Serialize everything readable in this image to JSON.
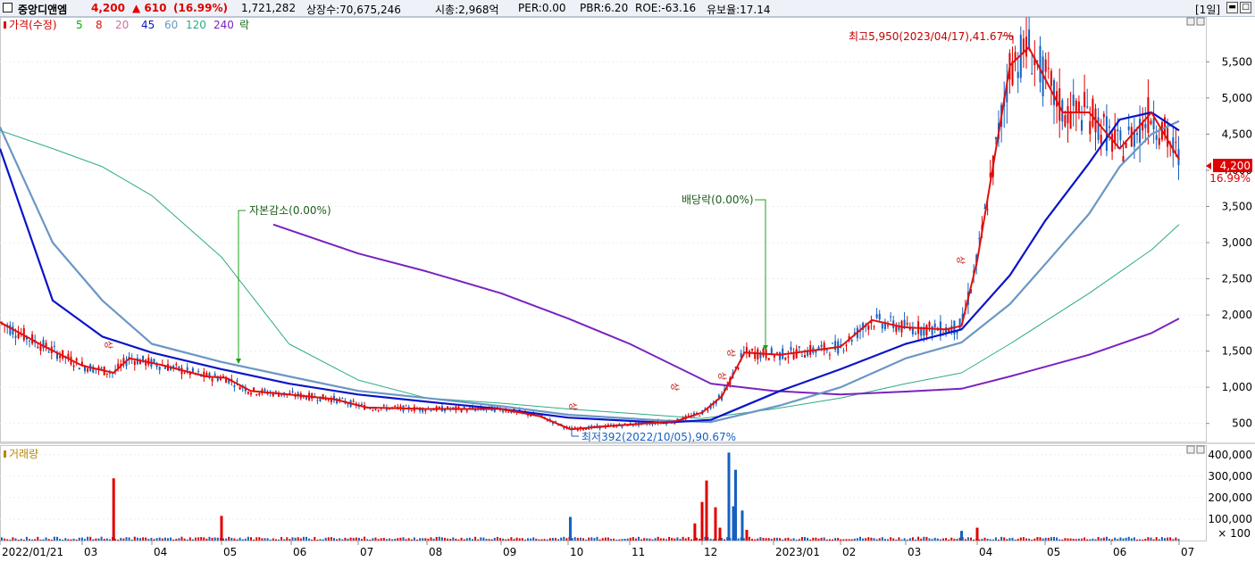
{
  "header": {
    "stock_name": "중앙디앤엠",
    "price": "4,200",
    "change": "▲ 610",
    "change_pct": "(16.99%)",
    "volume": "1,721,282",
    "shares": "상장수:70,675,246",
    "mcap": "시총:2,968억",
    "per": "PER:0.00",
    "pbr": "PBR:6.20",
    "roe": "ROE:-63.16",
    "float": "유보율:17.14",
    "period": "[1일]"
  },
  "legend": {
    "price_label": "가격(수정)",
    "ma": [
      "5",
      "8",
      "20",
      "45",
      "60",
      "120",
      "240"
    ],
    "extra": "락"
  },
  "annotations": {
    "high": "최고5,950(2023/04/17),41.67%",
    "low": "최저392(2022/10/05),90.67%",
    "capital_reduction": "자본감소(0.00%)",
    "dividend": "배당락(0.00%)",
    "upper_limit": "상"
  },
  "last_price_tag": {
    "price": "4,200",
    "pct": "16.99%"
  },
  "volume_panel": {
    "title": "거래량",
    "unit": "× 100"
  },
  "colors": {
    "up": "#e00000",
    "down": "#1560c0",
    "ma5": "#00b000",
    "ma8": "#e01010",
    "ma20": "#d070a0",
    "ma45": "#0a14c8",
    "ma60": "#6b97c4",
    "ma120": "#2cab84",
    "ma240": "#7b22c0"
  },
  "chart_data": [
    {
      "type": "line",
      "title": "",
      "y_ticks": [
        500,
        1000,
        1500,
        2000,
        2500,
        3000,
        3500,
        4000,
        4500,
        5000,
        5500
      ],
      "y_tick_labels": [
        "500",
        "1,000",
        "1,500",
        "2,000",
        "2,500",
        "3,000",
        "3,500",
        "4,000",
        "4,500",
        "5,000",
        "5,500"
      ],
      "ylim": [
        250,
        6120
      ],
      "x_labels": [
        {
          "x": "2022-01-21",
          "label": "2022/01/21"
        },
        {
          "x": "2022-03-01",
          "label": "03"
        },
        {
          "x": "2022-04-01",
          "label": "04"
        },
        {
          "x": "2022-05-02",
          "label": "05"
        },
        {
          "x": "2022-06-02",
          "label": "06"
        },
        {
          "x": "2022-07-01",
          "label": "07"
        },
        {
          "x": "2022-08-01",
          "label": "08"
        },
        {
          "x": "2022-09-01",
          "label": "09"
        },
        {
          "x": "2022-10-04",
          "label": "10"
        },
        {
          "x": "2022-11-01",
          "label": "11"
        },
        {
          "x": "2022-12-01",
          "label": "12"
        },
        {
          "x": "2023-01-02",
          "label": "2023/01"
        },
        {
          "x": "2023-02-01",
          "label": "02"
        },
        {
          "x": "2023-03-02",
          "label": "03"
        },
        {
          "x": "2023-04-03",
          "label": "04"
        },
        {
          "x": "2023-05-02",
          "label": "05"
        },
        {
          "x": "2023-06-01",
          "label": "06"
        },
        {
          "x": "2023-07-03",
          "label": "07"
        }
      ],
      "series": [
        {
          "name": "8",
          "points": [
            [
              "2022-01-21",
              1900
            ],
            [
              "2022-02-10",
              1580
            ],
            [
              "2022-03-01",
              1300
            ],
            [
              "2022-03-15",
              1200
            ],
            [
              "2022-03-22",
              1400
            ],
            [
              "2022-04-05",
              1310
            ],
            [
              "2022-04-25",
              1150
            ],
            [
              "2022-05-04",
              1130
            ],
            [
              "2022-05-15",
              950
            ],
            [
              "2022-06-01",
              900
            ],
            [
              "2022-06-20",
              840
            ],
            [
              "2022-07-05",
              720
            ],
            [
              "2022-08-01",
              700
            ],
            [
              "2022-09-01",
              700
            ],
            [
              "2022-09-20",
              600
            ],
            [
              "2022-10-05",
              420
            ],
            [
              "2022-10-25",
              470
            ],
            [
              "2022-11-20",
              530
            ],
            [
              "2022-12-01",
              650
            ],
            [
              "2022-12-10",
              880
            ],
            [
              "2022-12-20",
              1480
            ],
            [
              "2023-01-05",
              1450
            ],
            [
              "2023-02-01",
              1560
            ],
            [
              "2023-02-15",
              1930
            ],
            [
              "2023-03-01",
              1830
            ],
            [
              "2023-03-20",
              1800
            ],
            [
              "2023-03-27",
              1850
            ],
            [
              "2023-04-03",
              2750
            ],
            [
              "2023-04-17",
              5450
            ],
            [
              "2023-04-25",
              5700
            ],
            [
              "2023-05-10",
              4800
            ],
            [
              "2023-05-22",
              4800
            ],
            [
              "2023-06-05",
              4300
            ],
            [
              "2023-06-20",
              4800
            ],
            [
              "2023-07-03",
              4150
            ]
          ]
        },
        {
          "name": "45",
          "points": [
            [
              "2022-01-21",
              4300
            ],
            [
              "2022-02-15",
              2200
            ],
            [
              "2022-03-10",
              1700
            ],
            [
              "2022-04-01",
              1480
            ],
            [
              "2022-05-02",
              1250
            ],
            [
              "2022-06-01",
              1050
            ],
            [
              "2022-07-01",
              900
            ],
            [
              "2022-08-01",
              800
            ],
            [
              "2022-09-01",
              700
            ],
            [
              "2022-10-04",
              580
            ],
            [
              "2022-11-15",
              510
            ],
            [
              "2022-12-05",
              550
            ],
            [
              "2023-01-05",
              950
            ],
            [
              "2023-02-01",
              1250
            ],
            [
              "2023-03-02",
              1600
            ],
            [
              "2023-03-27",
              1800
            ],
            [
              "2023-04-17",
              2550
            ],
            [
              "2023-05-02",
              3300
            ],
            [
              "2023-05-22",
              4100
            ],
            [
              "2023-06-05",
              4700
            ],
            [
              "2023-06-20",
              4800
            ],
            [
              "2023-07-03",
              4550
            ]
          ]
        },
        {
          "name": "60",
          "points": [
            [
              "2022-01-21",
              4600
            ],
            [
              "2022-02-15",
              3000
            ],
            [
              "2022-03-10",
              2200
            ],
            [
              "2022-04-01",
              1600
            ],
            [
              "2022-05-02",
              1350
            ],
            [
              "2022-06-01",
              1150
            ],
            [
              "2022-07-01",
              950
            ],
            [
              "2022-08-01",
              850
            ],
            [
              "2022-09-01",
              740
            ],
            [
              "2022-10-04",
              620
            ],
            [
              "2022-11-15",
              540
            ],
            [
              "2022-12-05",
              520
            ],
            [
              "2023-01-05",
              750
            ],
            [
              "2023-02-01",
              1000
            ],
            [
              "2023-03-02",
              1400
            ],
            [
              "2023-03-27",
              1620
            ],
            [
              "2023-04-17",
              2150
            ],
            [
              "2023-05-02",
              2700
            ],
            [
              "2023-05-22",
              3400
            ],
            [
              "2023-06-05",
              4050
            ],
            [
              "2023-06-20",
              4500
            ],
            [
              "2023-07-03",
              4680
            ]
          ]
        },
        {
          "name": "120",
          "points": [
            [
              "2022-01-21",
              4550
            ],
            [
              "2022-02-15",
              4300
            ],
            [
              "2022-03-10",
              4050
            ],
            [
              "2022-04-01",
              3650
            ],
            [
              "2022-05-02",
              2800
            ],
            [
              "2022-06-01",
              1600
            ],
            [
              "2022-07-01",
              1100
            ],
            [
              "2022-08-01",
              850
            ],
            [
              "2022-09-01",
              780
            ],
            [
              "2022-10-04",
              700
            ],
            [
              "2022-11-01",
              640
            ],
            [
              "2022-12-01",
              570
            ],
            [
              "2023-01-02",
              700
            ],
            [
              "2023-02-01",
              850
            ],
            [
              "2023-03-02",
              1050
            ],
            [
              "2023-03-27",
              1200
            ],
            [
              "2023-04-17",
              1600
            ],
            [
              "2023-05-22",
              2300
            ],
            [
              "2023-06-20",
              2900
            ],
            [
              "2023-07-03",
              3250
            ]
          ]
        },
        {
          "name": "240",
          "points": [
            [
              "2022-05-25",
              3250
            ],
            [
              "2022-07-01",
              2850
            ],
            [
              "2022-08-01",
              2600
            ],
            [
              "2022-09-01",
              2300
            ],
            [
              "2022-10-04",
              1950
            ],
            [
              "2022-11-01",
              1600
            ],
            [
              "2022-12-05",
              1050
            ],
            [
              "2023-01-02",
              950
            ],
            [
              "2023-02-01",
              900
            ],
            [
              "2023-03-02",
              940
            ],
            [
              "2023-03-27",
              980
            ],
            [
              "2023-04-17",
              1150
            ],
            [
              "2023-05-22",
              1450
            ],
            [
              "2023-06-20",
              1750
            ],
            [
              "2023-07-03",
              1950
            ]
          ]
        }
      ]
    },
    {
      "type": "bar",
      "title": "",
      "ylim": [
        0,
        420000
      ],
      "y_ticks": [
        100000,
        200000,
        300000,
        400000
      ],
      "y_tick_labels": [
        "100,000",
        "200,000",
        "300,000",
        "400,000"
      ],
      "x": [
        "2022-03-15",
        "2022-05-02",
        "2022-10-05",
        "2022-11-28",
        "2022-12-01",
        "2022-12-03",
        "2022-12-07",
        "2022-12-09",
        "2022-12-13",
        "2022-12-15",
        "2022-12-16",
        "2022-12-19",
        "2022-12-21",
        "2023-03-27",
        "2023-04-03"
      ],
      "values": [
        290000,
        115000,
        110000,
        80000,
        180000,
        280000,
        155000,
        60000,
        410000,
        160000,
        330000,
        140000,
        50000,
        45000,
        60000
      ],
      "colors": [
        "up",
        "up",
        "down",
        "up",
        "up",
        "up",
        "up",
        "up",
        "down",
        "down",
        "down",
        "down",
        "up",
        "down",
        "up"
      ]
    }
  ]
}
